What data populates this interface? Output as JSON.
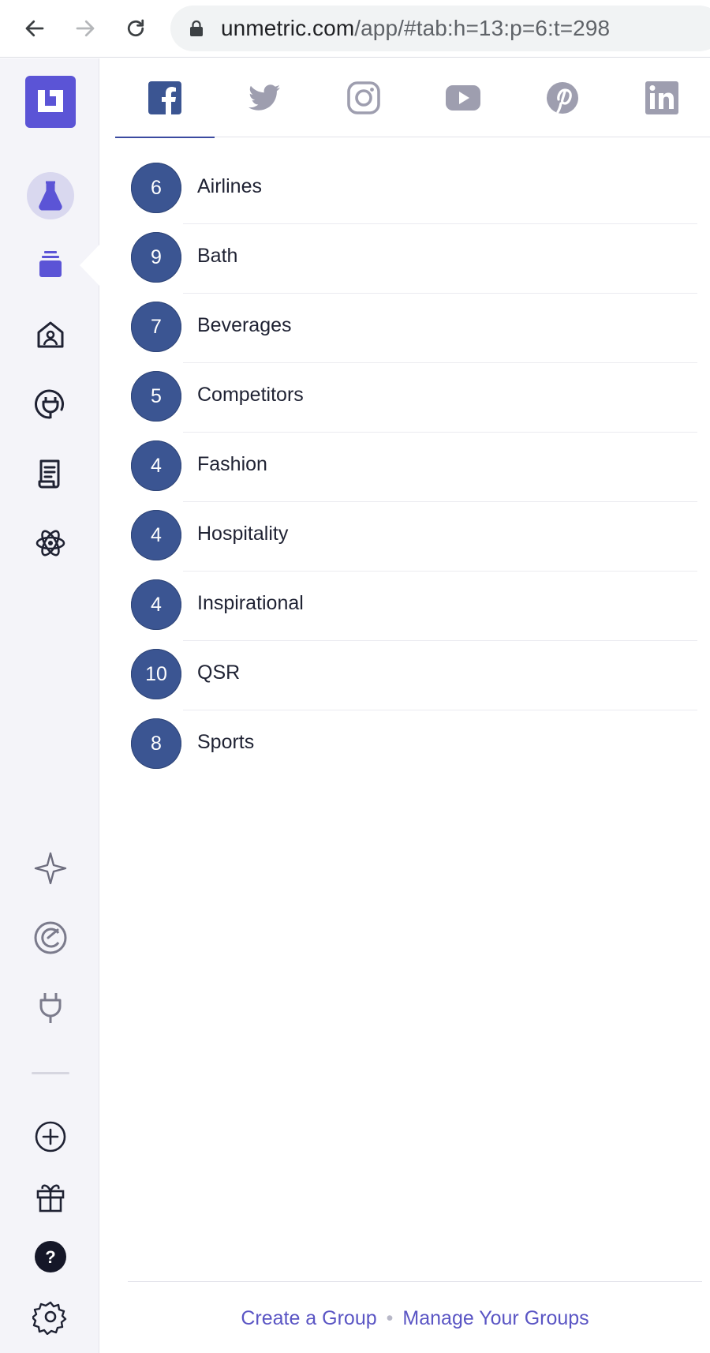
{
  "browser": {
    "url_host": "unmetric.com",
    "url_path": "/app/#tab:h=13:p=6:t=298"
  },
  "tabs": [
    {
      "name": "facebook",
      "icon": "facebook-icon",
      "active": true
    },
    {
      "name": "twitter",
      "icon": "twitter-icon",
      "active": false
    },
    {
      "name": "instagram",
      "icon": "instagram-icon",
      "active": false
    },
    {
      "name": "youtube",
      "icon": "youtube-icon",
      "active": false
    },
    {
      "name": "pinterest",
      "icon": "pinterest-icon",
      "active": false
    },
    {
      "name": "linkedin",
      "icon": "linkedin-icon",
      "active": false
    }
  ],
  "groups": [
    {
      "count": "6",
      "name": "Airlines"
    },
    {
      "count": "9",
      "name": "Bath"
    },
    {
      "count": "7",
      "name": "Beverages"
    },
    {
      "count": "5",
      "name": "Competitors"
    },
    {
      "count": "4",
      "name": "Fashion"
    },
    {
      "count": "4",
      "name": "Hospitality"
    },
    {
      "count": "4",
      "name": "Inspirational"
    },
    {
      "count": "10",
      "name": "QSR"
    },
    {
      "count": "8",
      "name": "Sports"
    }
  ],
  "footer": {
    "create_label": "Create a Group",
    "separator": "•",
    "manage_label": "Manage Your Groups"
  },
  "colors": {
    "brand": "#5b54d6",
    "badge": "#3b5592",
    "link": "#5a55c4",
    "rail_bg": "#f4f4f9"
  }
}
